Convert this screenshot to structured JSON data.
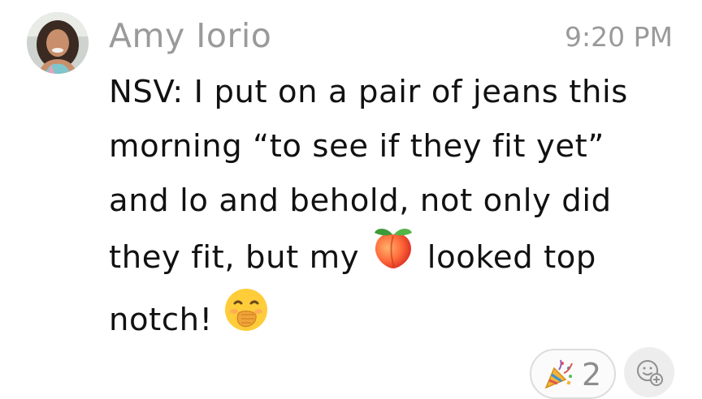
{
  "message": {
    "sender": "Amy Iorio",
    "time": "9:20 PM",
    "text": {
      "line1": "NSV: I put on a pair of jeans this",
      "line2": "morning “to see if they fit yet”",
      "line3": "and lo and behold, not only did",
      "line4_before": "they fit, but my",
      "line4_after": "looked top",
      "line5": "notch!"
    },
    "inline_emojis": [
      "peach-emoji",
      "hand-over-mouth-emoji"
    ]
  },
  "reactions": [
    {
      "icon": "party-popper-icon",
      "count": "2"
    }
  ],
  "add_reaction": {
    "icon": "add-emoji-reaction-icon"
  },
  "colors": {
    "meta_text": "#9a9a9a",
    "body_text": "#111111",
    "pill_border": "#dcdcdc",
    "add_button_bg": "#ededed"
  }
}
